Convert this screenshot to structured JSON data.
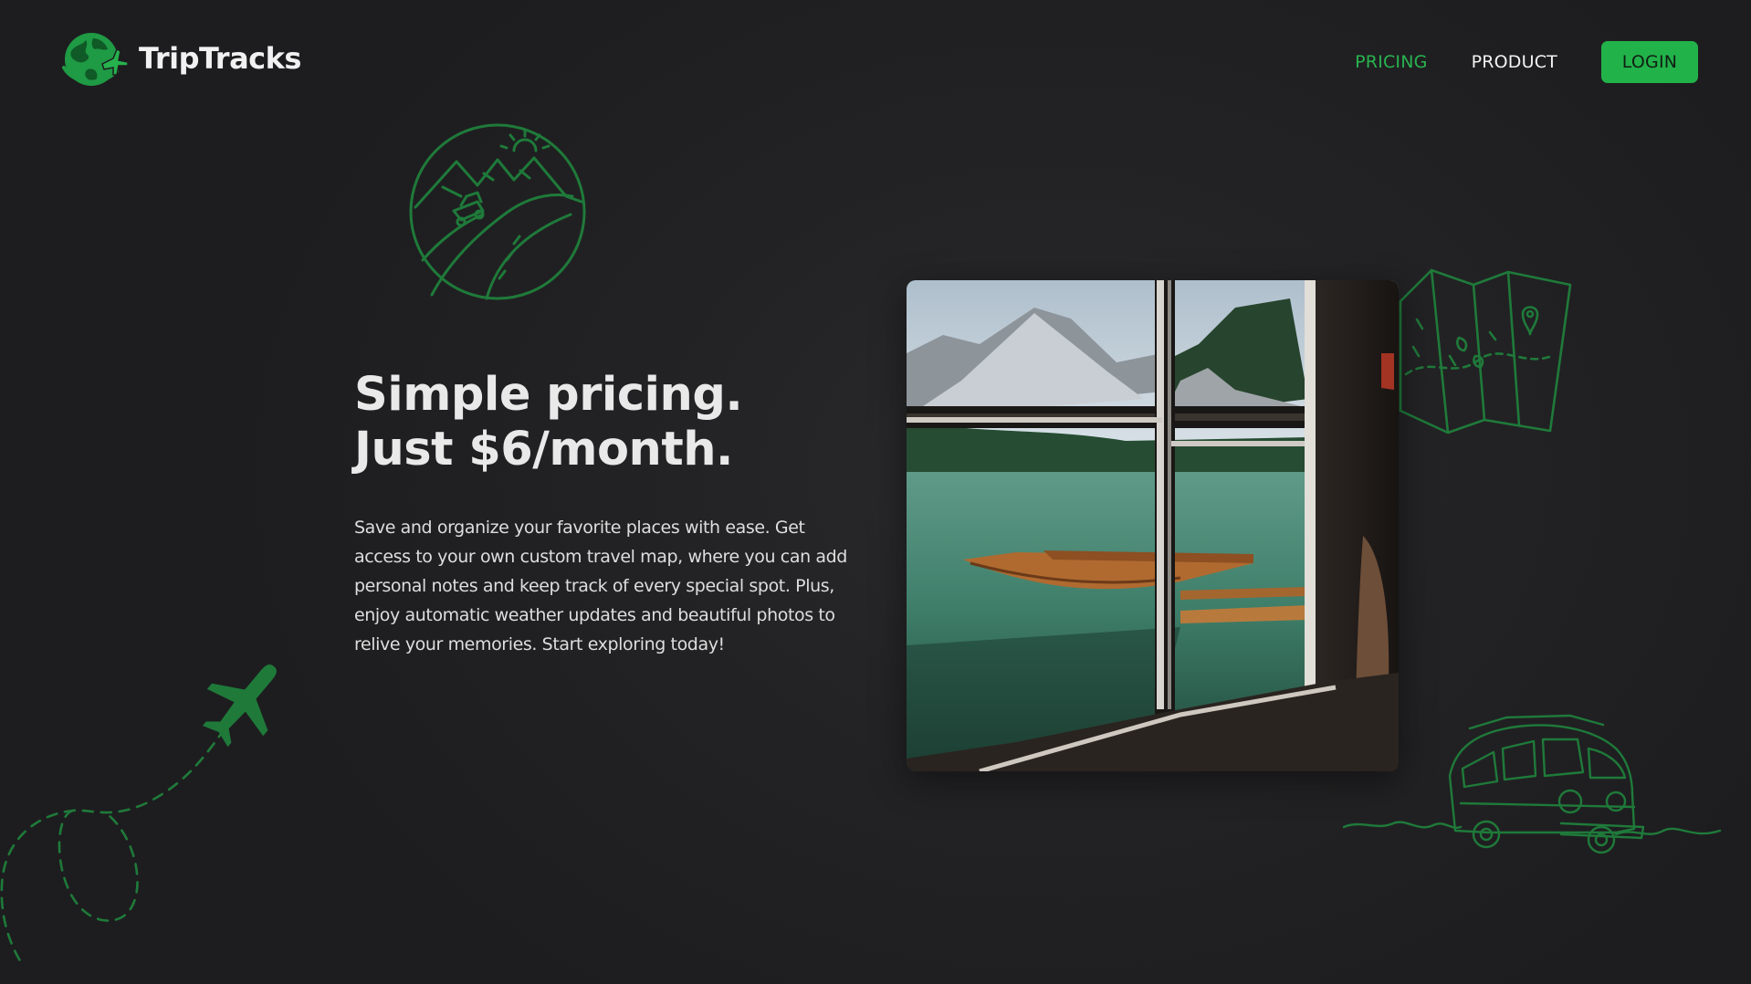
{
  "header": {
    "brand": "TripTracks",
    "nav": {
      "pricing_label": "PRICING",
      "product_label": "PRODUCT",
      "login_label": "LOGIN"
    }
  },
  "hero": {
    "title_line1": "Simple pricing.",
    "title_line2": "Just $6/month.",
    "body": "Save and organize your favorite places with ease. Get access to your own custom travel map, where you can add personal notes and keep track of every special spot. Plus, enjoy automatic weather updates and beautiful photos to relive your memories. Start exploring today!"
  },
  "icons": {
    "logo": "globe-airplane-icon",
    "mountain_road": "mountain-road-icon",
    "map": "folded-map-icon",
    "airplane": "airplane-icon",
    "van": "camper-van-icon",
    "flight_path": "dashed-flight-path"
  },
  "colors": {
    "accent": "#22b24a",
    "accent_text": "#28b44f",
    "background": "#1f1f21",
    "illustration": "#1f7a3a"
  }
}
